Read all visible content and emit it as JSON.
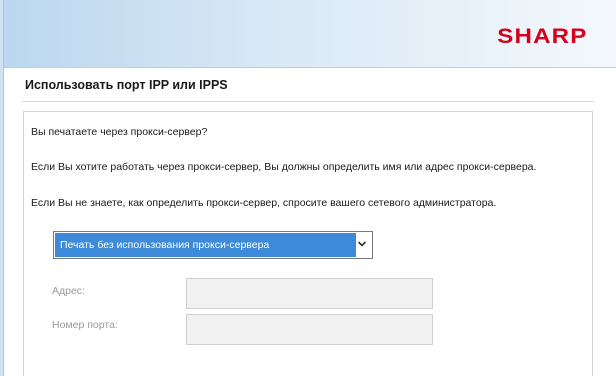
{
  "header": {
    "logo_text": "SHARP",
    "logo_color": "#d6001c"
  },
  "page": {
    "title": "Использовать порт IPP или IPPS"
  },
  "content": {
    "question": "Вы печатаете через прокси-сервер?",
    "info_line_1": "Если Вы хотите работать через прокси-сервер, Вы должны определить имя или адрес прокси-сервера.",
    "info_line_2": "Если Вы не знаете, как определить прокси-сервер, спросите вашего сетевого администратора."
  },
  "proxy_select": {
    "selected_value": "Печать без использования прокси-сервера",
    "highlight_color": "#3c8ad8",
    "icon": "chevron-down-icon"
  },
  "fields": {
    "address_label": "Адрес:",
    "address_value": "",
    "port_label": "Номер порта:",
    "port_value": "",
    "disabled": true
  }
}
